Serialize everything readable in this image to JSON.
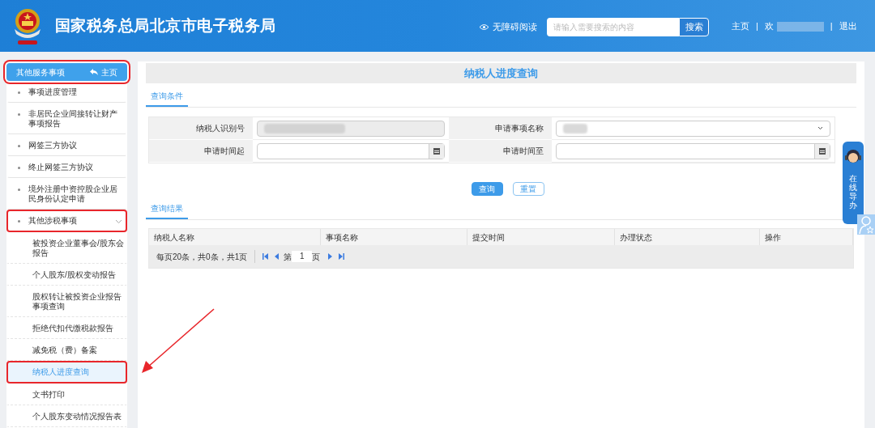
{
  "header": {
    "title": "国家税务总局北京市电子税务局",
    "accessibility": "无障碍阅读",
    "search": {
      "placeholder": "请输入需要搜索的内容",
      "button": "搜索"
    },
    "links": [
      {
        "kind": "link",
        "text": "主页"
      },
      {
        "kind": "sep",
        "text": "|"
      },
      {
        "kind": "user",
        "text": "欢"
      },
      {
        "kind": "sep",
        "text": "|"
      },
      {
        "kind": "link",
        "text": "退出"
      }
    ]
  },
  "sidebar": {
    "title": "其他服务事项",
    "home": "主页",
    "highlighted": true,
    "items": [
      {
        "label": "事项进度管理",
        "highlighted": false
      },
      {
        "label": "非居民企业间接转让财产事项报告",
        "highlighted": false
      },
      {
        "label": "网签三方协议",
        "highlighted": false
      },
      {
        "label": "终止网签三方协议",
        "highlighted": false
      },
      {
        "label": "境外注册中资控股企业居民身份认定申请",
        "highlighted": false
      },
      {
        "label": "其他涉税事项",
        "expanded": true,
        "highlighted": true,
        "children": [
          {
            "label": "被投资企业董事会/股东会报告",
            "selected": false,
            "highlighted": false
          },
          {
            "label": "个人股东/股权变动报告",
            "selected": false,
            "highlighted": false
          },
          {
            "label": "股权转让被投资企业报告事项查询",
            "selected": false,
            "highlighted": false
          },
          {
            "label": "拒绝代扣代缴税款报告",
            "selected": false,
            "highlighted": false
          },
          {
            "label": "减免税（费）备案",
            "selected": false,
            "highlighted": false
          },
          {
            "label": "纳税人进度查询",
            "selected": true,
            "highlighted": true
          },
          {
            "label": "文书打印",
            "selected": false,
            "highlighted": false
          },
          {
            "label": "个人股东变动情况报告表",
            "selected": false,
            "highlighted": false
          }
        ]
      }
    ]
  },
  "main": {
    "title": "纳税人进度查询",
    "conditions_tab": "查询条件",
    "form": [
      {
        "kind": "text",
        "label": "纳税人识别号",
        "disabled": true
      },
      {
        "kind": "select",
        "label": "申请事项名称",
        "disabled": false
      },
      {
        "kind": "date",
        "label": "申请时间起",
        "disabled": false
      },
      {
        "kind": "date",
        "label": "申请时间至",
        "disabled": false
      }
    ],
    "buttons": [
      {
        "kind": "primary",
        "text": "查询"
      },
      {
        "kind": "outline",
        "text": "重置"
      }
    ],
    "results_tab": "查询结果",
    "table": {
      "columns": [
        "纳税人名称",
        "事项名称",
        "提交时间",
        "办理状态",
        "操作"
      ]
    },
    "pager": {
      "summary": "每页20条，共0条，共1页",
      "before": "第",
      "page": "1",
      "after": "页"
    }
  },
  "float_widget": {
    "text": "在线导办"
  }
}
